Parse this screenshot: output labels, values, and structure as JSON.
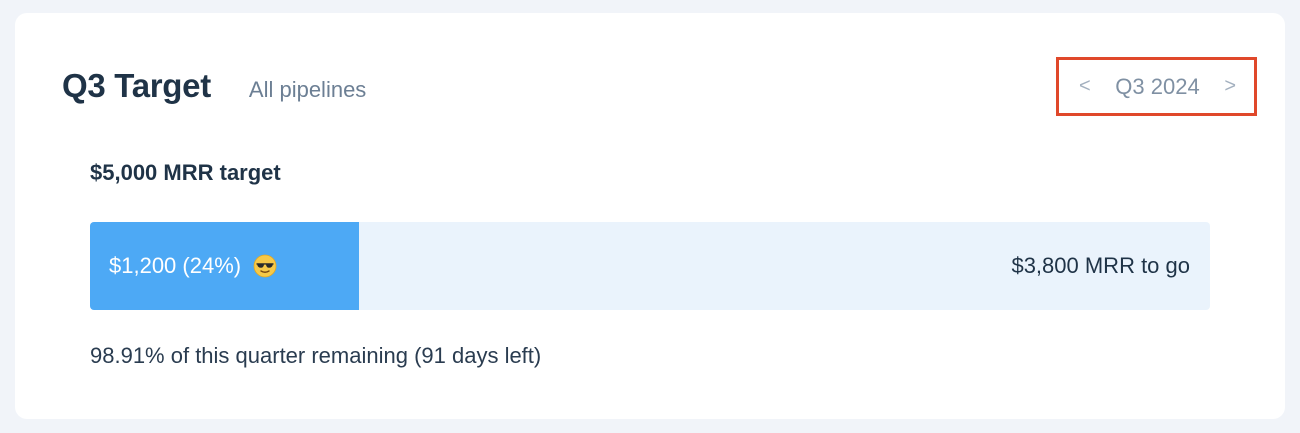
{
  "card": {
    "title": "Q3 Target",
    "subtitle": "All pipelines"
  },
  "quarter_nav": {
    "prev_label": "<",
    "current": "Q3 2024",
    "next_label": ">"
  },
  "target": {
    "label": "$5,000 MRR target",
    "achieved_text": "$1,200 (24%)",
    "achieved_fraction": 0.24,
    "emoji_icon": "sunglasses-face-icon",
    "remaining_text": "$3,800 MRR to go"
  },
  "footer": {
    "time_remaining": "98.91% of this quarter remaining (91 days left)"
  },
  "colors": {
    "progress_fill": "#4da9f5",
    "progress_track": "#eaf3fc",
    "highlight_border": "#e0482a",
    "title_text": "#1f3347"
  }
}
